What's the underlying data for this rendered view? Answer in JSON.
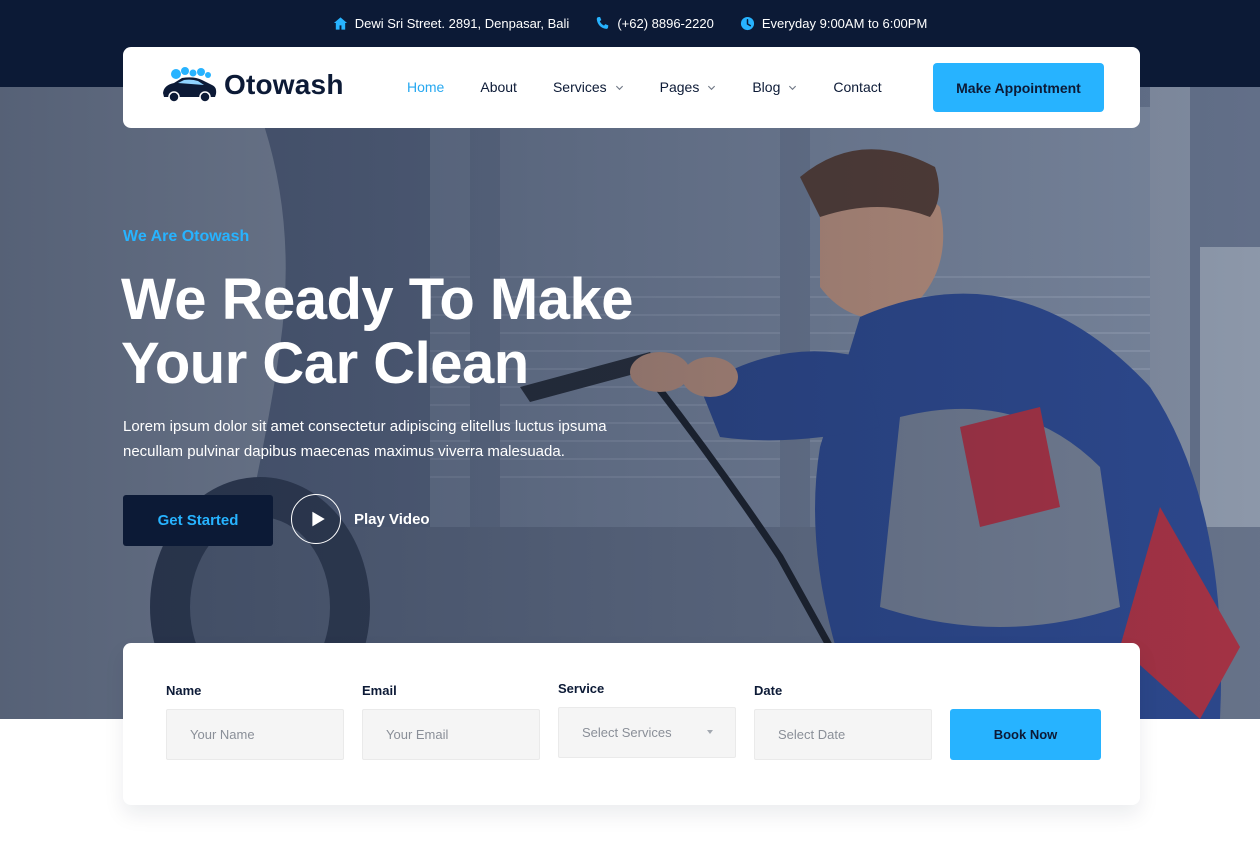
{
  "topbar": {
    "address": "Dewi Sri Street. 2891, Denpasar, Bali",
    "phone": "(+62) 8896-2220",
    "hours": "Everyday 9:00AM to 6:00PM"
  },
  "brand": {
    "name": "Otowash"
  },
  "nav": {
    "items": [
      {
        "label": "Home",
        "active": true
      },
      {
        "label": "About"
      },
      {
        "label": "Services",
        "dropdown": true
      },
      {
        "label": "Pages",
        "dropdown": true
      },
      {
        "label": "Blog",
        "dropdown": true
      },
      {
        "label": "Contact"
      }
    ],
    "cta_label": "Make Appointment"
  },
  "hero": {
    "eyebrow": "We Are Otowash",
    "headline_line1": "We Ready To Make",
    "headline_line2": "Your Car Clean",
    "lead": "Lorem ipsum dolor sit amet consectetur adipiscing elitellus luctus ipsuma necullam pulvinar dapibus maecenas maximus viverra malesuada.",
    "primary_button": "Get Started",
    "video_button": "Play Video"
  },
  "booking": {
    "name_label": "Name",
    "name_placeholder": "Your Name",
    "email_label": "Email",
    "email_placeholder": "Your Email",
    "service_label": "Service",
    "service_selected": "Select Services",
    "date_label": "Date",
    "date_placeholder": "Select Date",
    "submit_label": "Book Now"
  },
  "colors": {
    "navy": "#0c1a36",
    "accent": "#27b3ff",
    "white": "#ffffff"
  }
}
